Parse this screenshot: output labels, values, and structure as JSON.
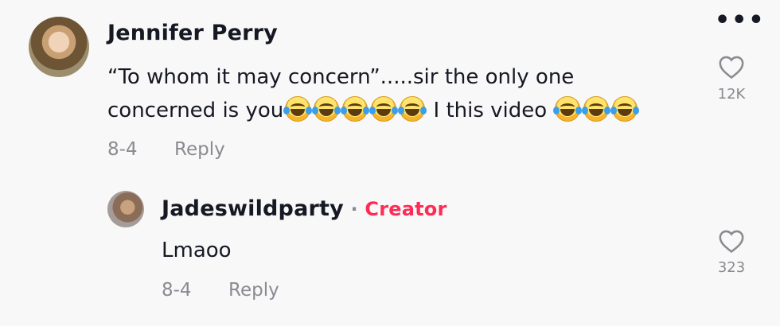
{
  "comment": {
    "username": "Jennifer Perry",
    "text_line1": "“To whom it may concern”.....sir the only one",
    "text_line2_start": "concerned is you",
    "text_line2_mid": " I this video ",
    "date": "8-4",
    "reply_label": "Reply",
    "likes": "12K"
  },
  "reply": {
    "username": "Jadeswildparty",
    "separator": " · ",
    "badge": "Creator",
    "text": "Lmaoo",
    "date": "8-4",
    "reply_label": "Reply",
    "likes": "323"
  },
  "icons": {
    "more": "more-horizontal-icon",
    "like": "heart-outline-icon",
    "emoji": "face-with-tears-of-joy"
  },
  "colors": {
    "creator_accent": "#fe2c55",
    "meta_gray": "#8a8b91",
    "background": "#f8f8f8"
  }
}
